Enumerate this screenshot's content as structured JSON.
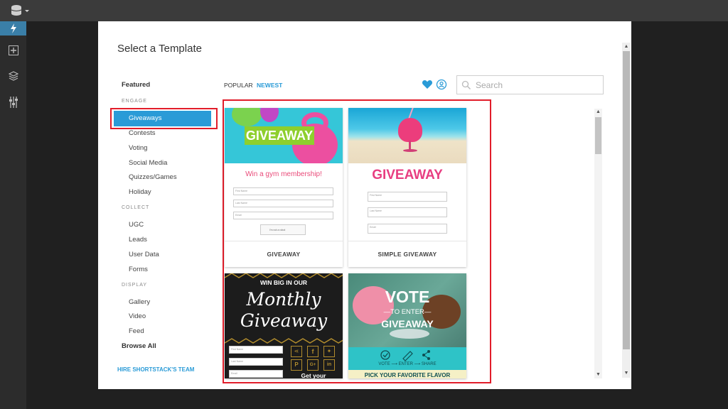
{
  "modal": {
    "title": "Select a Template"
  },
  "categories": {
    "featured": "Featured",
    "sections": [
      {
        "heading": "ENGAGE",
        "items": [
          "Giveaways",
          "Contests",
          "Voting",
          "Social Media",
          "Quizzes/Games",
          "Holiday"
        ]
      },
      {
        "heading": "COLLECT",
        "items": [
          "UGC",
          "Leads",
          "User Data",
          "Forms"
        ]
      },
      {
        "heading": "DISPLAY",
        "items": [
          "Gallery",
          "Video",
          "Feed"
        ]
      }
    ],
    "selected": "Giveaways",
    "browse_all": "Browse All",
    "hire": "HIRE SHORTSTACK'S TEAM"
  },
  "sort": {
    "popular": "POPULAR",
    "newest": "NEWEST"
  },
  "search": {
    "placeholder": "Search"
  },
  "templates": [
    {
      "name": "GIVEAWAY",
      "banner": "GIVEAWAY",
      "subtitle": "Win a gym membership!",
      "fields": [
        "First Name",
        "Last Name",
        "Email"
      ],
      "captcha": "I'm not a robot"
    },
    {
      "name": "SIMPLE GIVEAWAY",
      "banner": "GIVEAWAY",
      "fields": [
        "First Name",
        "Last Name",
        "Email"
      ]
    },
    {
      "line1": "WIN BIG IN OUR",
      "line2": "Monthly",
      "line3": "Giveaway",
      "fields": [
        "First Name",
        "Last Name",
        "Email"
      ],
      "cta": "Get your"
    },
    {
      "line1": "VOTE",
      "line2": "—TO ENTER—",
      "line3": "GIVEAWAY",
      "steps": "VOTE ⟶ ENTER ⟶ SHARE",
      "bottom": "PICK YOUR FAVORITE FLAVOR"
    }
  ],
  "colors": {
    "accent": "#2a9bd7",
    "highlight": "#e11d2a"
  }
}
